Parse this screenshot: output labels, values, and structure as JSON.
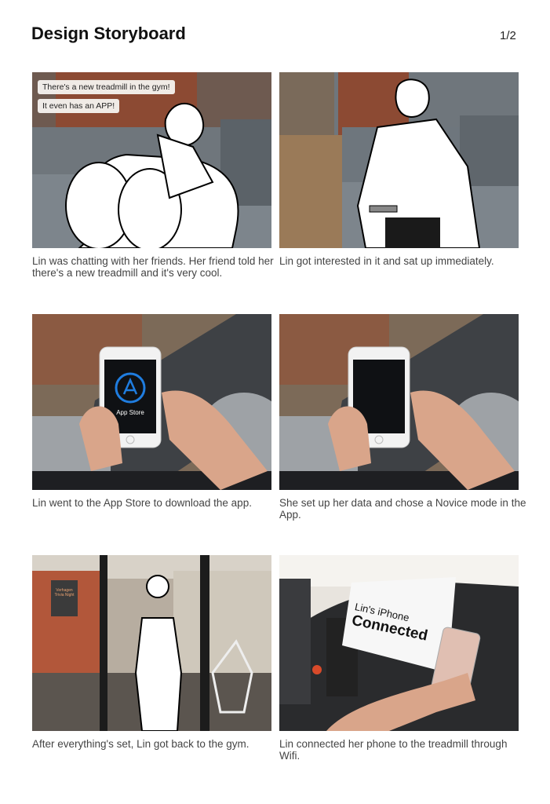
{
  "header": {
    "title": "Design Storyboard",
    "page": "1/2"
  },
  "panels": [
    {
      "bubbles": [
        "There's a new treadmill in the gym!",
        "It even has an APP!"
      ],
      "caption": "Lin was chatting with her friends. Her friend told her there's a new treadmill and it's very cool."
    },
    {
      "caption": "Lin got interested in it and sat up immediately."
    },
    {
      "screen_label": "App Store",
      "caption": "Lin went to the App Store to download the app."
    },
    {
      "caption": "She set up her data and chose a Novice mode in the App."
    },
    {
      "sign_text": [
        "Verhagen",
        "Trivia Night"
      ],
      "caption": "After everything's set, Lin got back to the gym."
    },
    {
      "console_lines": [
        "Lin's iPhone",
        "Connected"
      ],
      "caption": "Lin connected her phone to the treadmill through Wifi."
    }
  ],
  "colors": {
    "sofa": "#7d858c",
    "brick": "#8c4a33",
    "floor": "#9a7a58",
    "jeans": "#8f9296",
    "skin": "#d9a58a",
    "phone": "#f2f2f2",
    "appstore_blue": "#1f7de0"
  }
}
